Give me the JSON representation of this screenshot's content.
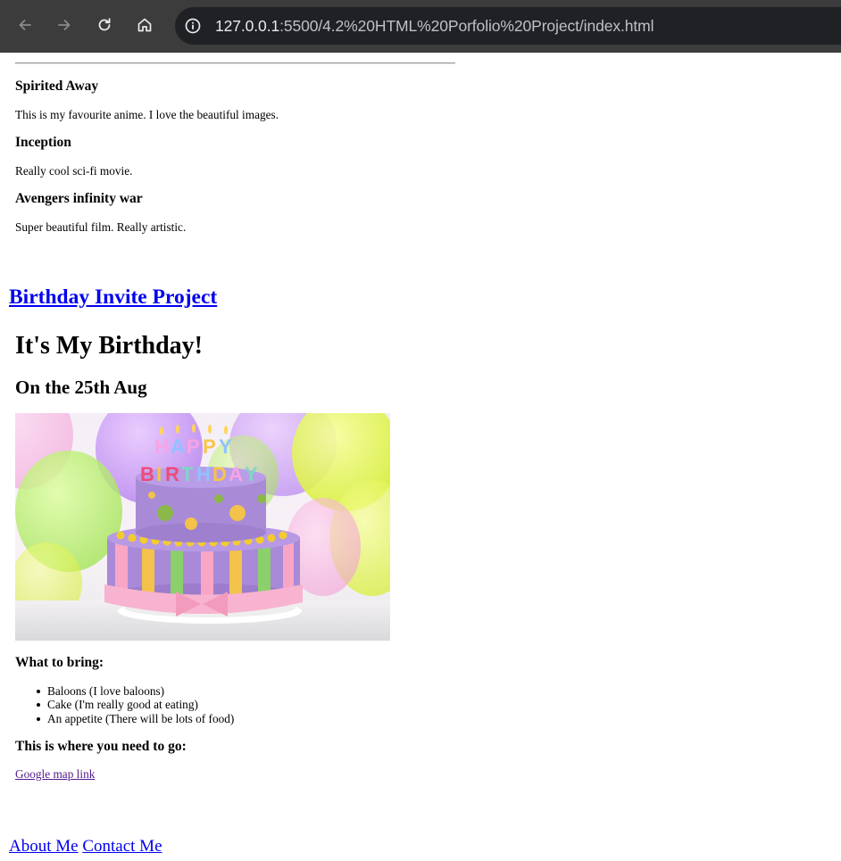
{
  "browser": {
    "url_host": "127.0.0.1",
    "url_rest": ":5500/4.2%20HTML%20Porfolio%20Project/index.html",
    "icons": [
      "back-arrow-icon",
      "forward-arrow-icon",
      "reload-icon",
      "home-icon",
      "info-icon"
    ]
  },
  "movies": [
    {
      "title": "Spirited Away",
      "description": "This is my favourite anime. I love the beautiful images."
    },
    {
      "title": "Inception",
      "description": "Really cool sci-fi movie."
    },
    {
      "title": "Avengers infinity war",
      "description": "Super beautiful film. Really artistic."
    }
  ],
  "project_link": "Birthday Invite Project",
  "birthday": {
    "heading": "It's My Birthday!",
    "date": "On the 25th Aug",
    "cake_text_line1": "HAPPY",
    "cake_text_line2": "BIRTHDAY",
    "bring_heading": "What to bring:",
    "bring_items": [
      "Baloons (I love baloons)",
      "Cake (I'm really good at eating)",
      "An appetite (There will be lots of food)"
    ],
    "where_heading": "This is where you need to go:",
    "map_link": "Google map link"
  },
  "footer": {
    "about": "About Me",
    "contact": "Contact Me"
  },
  "colors": {
    "toolbar": "#3c3c3c",
    "omnibox": "#202124",
    "link": "#0000ee",
    "visited_link": "#551a8b"
  }
}
